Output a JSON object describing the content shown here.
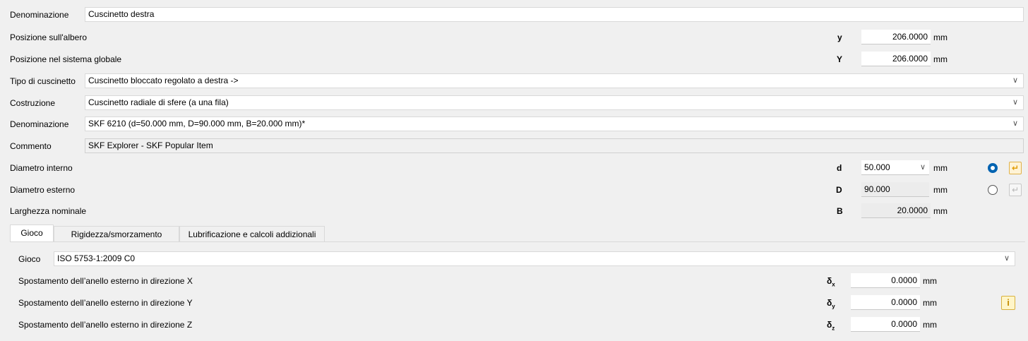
{
  "header": {
    "label": "Denominazione",
    "value": "Cuscinetto destra"
  },
  "position_shaft": {
    "label": "Posizione sull'albero",
    "symbol": "y",
    "value": "206.0000",
    "unit": "mm"
  },
  "position_global": {
    "label": "Posizione nel sistema globale",
    "symbol": "Y",
    "value": "206.0000",
    "unit": "mm"
  },
  "bearing_type": {
    "label": "Tipo di cuscinetto",
    "value": "Cuscinetto bloccato regolato a destra ->"
  },
  "construction": {
    "label": "Costruzione",
    "value": "Cuscinetto radiale di sfere (a una fila)"
  },
  "designation": {
    "label": "Denominazione",
    "value": "SKF 6210 (d=50.000 mm, D=90.000 mm, B=20.000 mm)*"
  },
  "comment": {
    "label": "Commento",
    "value": "SKF Explorer - SKF Popular Item"
  },
  "inner_diameter": {
    "label": "Diametro interno",
    "symbol": "d",
    "value": "50.000",
    "unit": "mm",
    "radio_selected": true
  },
  "outer_diameter": {
    "label": "Diametro esterno",
    "symbol": "D",
    "value": "90.000",
    "unit": "mm",
    "radio_selected": false
  },
  "nominal_width": {
    "label": "Larghezza nominale",
    "symbol": "B",
    "value": "20.0000",
    "unit": "mm"
  },
  "tabs": [
    {
      "label": "Gioco",
      "active": true
    },
    {
      "label": "Rigidezza/smorzamento",
      "active": false
    },
    {
      "label": "Lubrificazione e calcoli addizionali",
      "active": false
    }
  ],
  "clearance": {
    "label": "Gioco",
    "value": "ISO 5753-1:2009 C0",
    "rows": [
      {
        "label": "Spostamento dell’anello esterno in direzione X",
        "symbol": "δ",
        "sub": "x",
        "value": "0.0000",
        "unit": "mm"
      },
      {
        "label": "Spostamento dell’anello esterno in direzione Y",
        "symbol": "δ",
        "sub": "y",
        "value": "0.0000",
        "unit": "mm"
      },
      {
        "label": "Spostamento dell’anello esterno in direzione Z",
        "symbol": "δ",
        "sub": "z",
        "value": "0.0000",
        "unit": "mm"
      }
    ]
  },
  "icons": {
    "chevron": "∨",
    "enter_arrow": "↵",
    "info": "i"
  },
  "colors": {
    "radio_selected": "#0063b1",
    "active_button": "#e29b00"
  }
}
